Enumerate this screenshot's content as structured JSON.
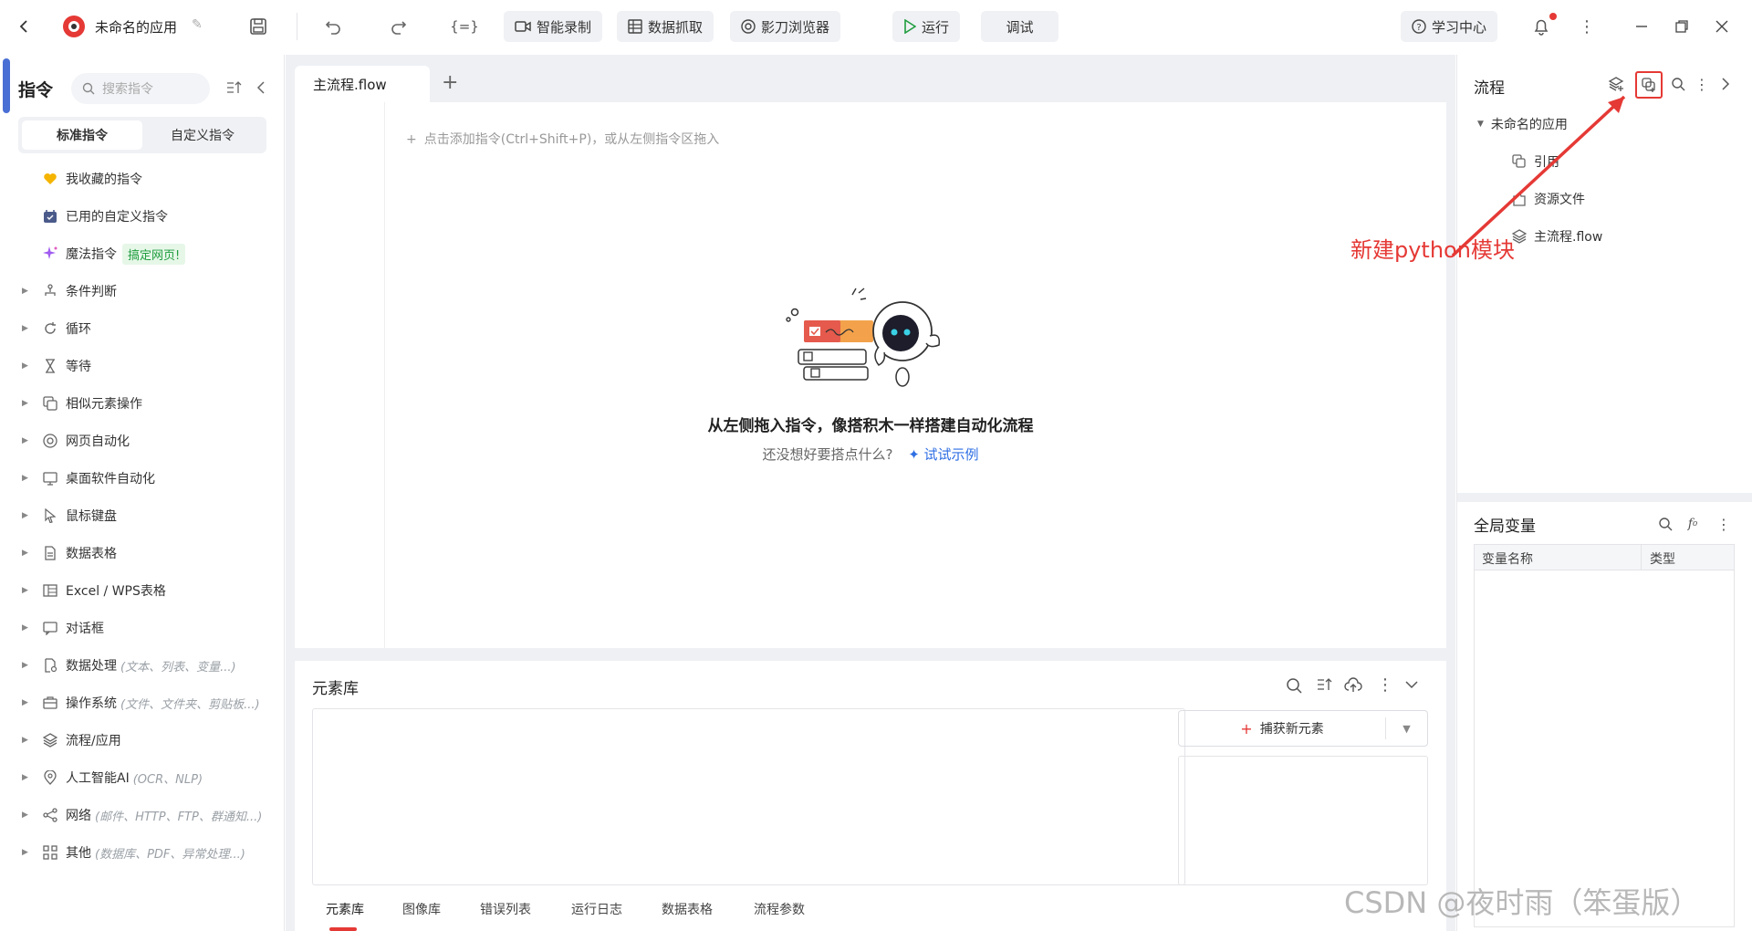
{
  "topbar": {
    "app_title": "未命名的应用",
    "smart_record": "智能录制",
    "data_capture": "数据抓取",
    "browser": "影刀浏览器",
    "run": "运行",
    "debug": "调试",
    "learning_center": "学习中心"
  },
  "left": {
    "title": "指令",
    "search_placeholder": "搜索指令",
    "tabs": [
      "标准指令",
      "自定义指令"
    ],
    "favorites": "我收藏的指令",
    "used_custom": "已用的自定义指令",
    "magic": "魔法指令",
    "magic_tag": "搞定网页!",
    "categories": [
      {
        "label": "条件判断",
        "hint": "",
        "icon": "branch-icon"
      },
      {
        "label": "循环",
        "hint": "",
        "icon": "loop-icon"
      },
      {
        "label": "等待",
        "hint": "",
        "icon": "hourglass-icon"
      },
      {
        "label": "相似元素操作",
        "hint": "",
        "icon": "copy-icon"
      },
      {
        "label": "网页自动化",
        "hint": "",
        "icon": "chrome-icon"
      },
      {
        "label": "桌面软件自动化",
        "hint": "",
        "icon": "monitor-icon"
      },
      {
        "label": "鼠标键盘",
        "hint": "",
        "icon": "cursor-icon"
      },
      {
        "label": "数据表格",
        "hint": "",
        "icon": "document-icon"
      },
      {
        "label": "Excel / WPS表格",
        "hint": "",
        "icon": "excel-icon"
      },
      {
        "label": "对话框",
        "hint": "",
        "icon": "dialog-icon"
      },
      {
        "label": "数据处理",
        "hint": "(文本、列表、变量...)",
        "icon": "data-process-icon"
      },
      {
        "label": "操作系统",
        "hint": "(文件、文件夹、剪贴板...)",
        "icon": "briefcase-icon"
      },
      {
        "label": "流程/应用",
        "hint": "",
        "icon": "layers-icon"
      },
      {
        "label": "人工智能AI",
        "hint": "(OCR、NLP)",
        "icon": "ai-icon"
      },
      {
        "label": "网络",
        "hint": "(邮件、HTTP、FTP、群通知...)",
        "icon": "share-icon"
      },
      {
        "label": "其他",
        "hint": "(数据库、PDF、异常处理...)",
        "icon": "grid-icon"
      }
    ]
  },
  "editor": {
    "tab": "主流程.flow",
    "add_hint": "点击添加指令(Ctrl+Shift+P)，或从左侧指令区拖入",
    "empty_title": "从左侧拖入指令，像搭积木一样搭建自动化流程",
    "empty_sub": "还没想好要搭点什么?",
    "try_example": "试试示例"
  },
  "element_lib": {
    "title": "元素库",
    "capture": "捕获新元素",
    "bottom_tabs": [
      "元素库",
      "图像库",
      "错误列表",
      "运行日志",
      "数据表格",
      "流程参数"
    ]
  },
  "right": {
    "flow_title": "流程",
    "tree_root": "未命名的应用",
    "tree_items": [
      "引用",
      "资源文件",
      "主流程.flow"
    ],
    "vars_title": "全局变量",
    "var_cols": [
      "变量名称",
      "类型"
    ]
  },
  "annotation": "新建python模块",
  "watermark": "CSDN @夜时雨（笨蛋版）",
  "colors": {
    "accent": "#2f6fe4",
    "annotation": "#e53935",
    "run_green": "#1f9d3f"
  }
}
